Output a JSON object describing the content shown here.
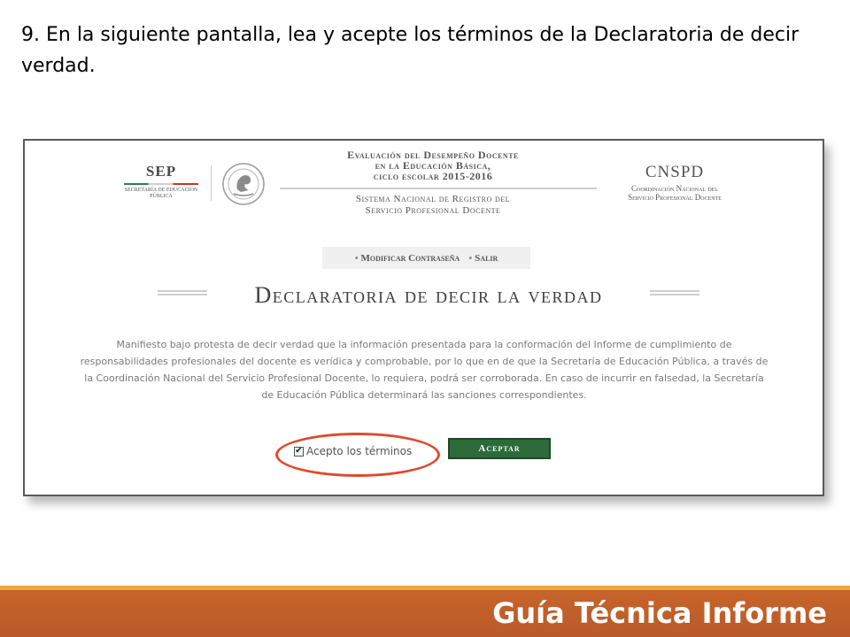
{
  "slide": {
    "instruction": "9. En la siguiente pantalla, lea y acepte los términos de la Declaratoria de decir verdad."
  },
  "header": {
    "sep": {
      "title": "SEP",
      "subtitle": "SECRETARÍA DE EDUCACIÓN PÚBLICA"
    },
    "evaluation": {
      "title_line1": "Evaluación del Desempeño Docente",
      "title_line2": "en la Educación Básica,",
      "title_line3": "ciclo escolar 2015-2016",
      "system_line1": "Sistema Nacional de Registro del",
      "system_line2": "Servicio Profesional Docente"
    },
    "cnspd": {
      "title": "CNSPD",
      "subtitle_line1": "Coordinación Nacional del",
      "subtitle_line2": "Servicio Profesional Docente"
    }
  },
  "nav": {
    "change_password": "Modificar Contraseña",
    "logout": "Salir"
  },
  "main": {
    "heading": "Declaratoria de decir la verdad",
    "paragraph_lines": [
      "Manifiesto bajo protesta de decir verdad que la información presentada para la conformación del Informe de cumplimiento de",
      "responsabilidades profesionales del docente es verídica y comprobable, por lo que en de que la Secretaría de Educación Pública, a través de",
      "la Coordinación Nacional del Servicio Profesional Docente, lo requiera, podrá ser corroborada. En caso de incurrir en falsedad, la Secretaría",
      "de Educación Pública determinará las sanciones correspondientes."
    ]
  },
  "actions": {
    "accept_terms_label": "Acepto los términos",
    "accept_terms_checked": true,
    "accept_button": "Aceptar"
  },
  "footer": {
    "text": "Guía Técnica Informe"
  },
  "colors": {
    "highlight": "#de4a2e",
    "button": "#2c6a3c",
    "footer": "#c8642a",
    "footer_strip": "#f0a637"
  }
}
